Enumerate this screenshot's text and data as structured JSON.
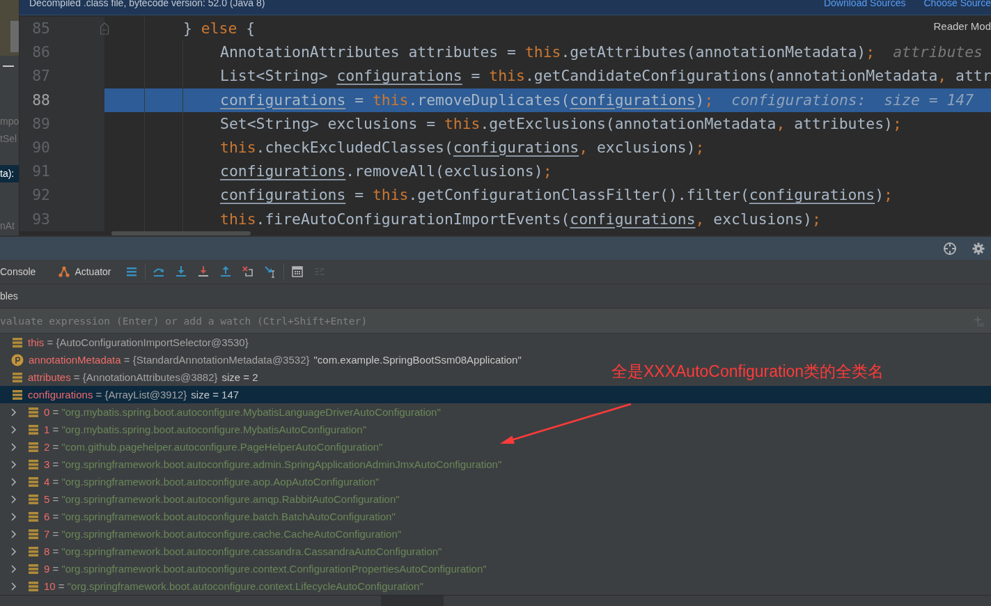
{
  "side_panel": {
    "fragments": [
      {
        "text": "mpo",
        "selected": false
      },
      {
        "text": "tSel",
        "selected": false
      },
      {
        "text": "ta):",
        "selected": true
      },
      {
        "text": "nAt",
        "selected": false
      }
    ]
  },
  "banner": {
    "message": "Decompiled .class file, bytecode version: 52.0 (Java 8)",
    "links": [
      "Download Sources",
      "Choose Source"
    ]
  },
  "editor": {
    "reader_mode": "Reader Mod",
    "lines": [
      {
        "number": "85",
        "current": false,
        "tokens": [
          {
            "kind": "plain",
            "text": "} "
          },
          {
            "kind": "keyword",
            "text": "else"
          },
          {
            "kind": "plain",
            "text": " {"
          }
        ],
        "children": [
          {
            "number": "86",
            "current": false,
            "tokens": [
              {
                "kind": "plain",
                "text": "AnnotationAttributes attributes = "
              },
              {
                "kind": "keyword",
                "text": "this"
              },
              {
                "kind": "plain",
                "text": ".getAttributes(annotationMetadata)"
              },
              {
                "kind": "keyword",
                "text": ";"
              }
            ],
            "hint": "attributes"
          },
          {
            "number": "87",
            "current": false,
            "tokens": [
              {
                "kind": "plain",
                "text": "List<String> "
              },
              {
                "kind": "variable",
                "text": "configurations"
              },
              {
                "kind": "plain",
                "text": " = "
              },
              {
                "kind": "keyword",
                "text": "this"
              },
              {
                "kind": "plain",
                "text": ".getCandidateConfigurations(annotationMetadata"
              },
              {
                "kind": "keyword",
                "text": ","
              },
              {
                "kind": "plain",
                "text": " attr"
              }
            ]
          },
          {
            "number": "88",
            "current": true,
            "tokens": [
              {
                "kind": "variable",
                "text": "configurations"
              },
              {
                "kind": "plain",
                "text": " = "
              },
              {
                "kind": "keyword",
                "text": "this"
              },
              {
                "kind": "plain",
                "text": ".removeDuplicates("
              },
              {
                "kind": "variable",
                "text": "configurations"
              },
              {
                "kind": "plain",
                "text": ")"
              },
              {
                "kind": "keyword",
                "text": ";"
              }
            ],
            "hint": "configurations:  size = 147"
          },
          {
            "number": "89",
            "current": false,
            "tokens": [
              {
                "kind": "plain",
                "text": "Set<String> exclusions = "
              },
              {
                "kind": "keyword",
                "text": "this"
              },
              {
                "kind": "plain",
                "text": ".getExclusions(annotationMetadata"
              },
              {
                "kind": "keyword",
                "text": ","
              },
              {
                "kind": "plain",
                "text": " attributes)"
              },
              {
                "kind": "keyword",
                "text": ";"
              }
            ]
          },
          {
            "number": "90",
            "current": false,
            "tokens": [
              {
                "kind": "keyword",
                "text": "this"
              },
              {
                "kind": "plain",
                "text": ".checkExcludedClasses("
              },
              {
                "kind": "variable",
                "text": "configurations"
              },
              {
                "kind": "keyword",
                "text": ","
              },
              {
                "kind": "plain",
                "text": " exclusions)"
              },
              {
                "kind": "keyword",
                "text": ";"
              }
            ]
          },
          {
            "number": "91",
            "current": false,
            "tokens": [
              {
                "kind": "variable",
                "text": "configurations"
              },
              {
                "kind": "plain",
                "text": ".removeAll(exclusions)"
              },
              {
                "kind": "keyword",
                "text": ";"
              }
            ]
          },
          {
            "number": "92",
            "current": false,
            "tokens": [
              {
                "kind": "variable",
                "text": "configurations"
              },
              {
                "kind": "plain",
                "text": " = "
              },
              {
                "kind": "keyword",
                "text": "this"
              },
              {
                "kind": "plain",
                "text": ".getConfigurationClassFilter().filter("
              },
              {
                "kind": "variable",
                "text": "configurations"
              },
              {
                "kind": "plain",
                "text": ")"
              },
              {
                "kind": "keyword",
                "text": ";"
              }
            ]
          },
          {
            "number": "93",
            "current": false,
            "tokens": [
              {
                "kind": "keyword",
                "text": "this"
              },
              {
                "kind": "plain",
                "text": ".fireAutoConfigurationImportEvents("
              },
              {
                "kind": "variable",
                "text": "configurations"
              },
              {
                "kind": "keyword",
                "text": ","
              },
              {
                "kind": "plain",
                "text": " exclusions)"
              },
              {
                "kind": "keyword",
                "text": ";"
              }
            ]
          }
        ]
      }
    ]
  },
  "debug": {
    "tabs": [
      {
        "label": "Console",
        "kind": "plain"
      },
      {
        "label": "Actuator",
        "kind": "actuator"
      }
    ],
    "toolbar_groups": [
      [
        {
          "kind": "layout",
          "disabled": false
        }
      ],
      [
        {
          "kind": "step-over",
          "disabled": false
        },
        {
          "kind": "step-into",
          "disabled": false
        },
        {
          "kind": "force-step-into",
          "disabled": false
        },
        {
          "kind": "step-out",
          "disabled": false
        },
        {
          "kind": "drop-frame",
          "disabled": false
        },
        {
          "kind": "run-to-cursor",
          "disabled": false
        }
      ],
      [
        {
          "kind": "evaluate",
          "disabled": false
        },
        {
          "kind": "trace",
          "disabled": true
        }
      ]
    ],
    "section_title": "bles",
    "watch_field": {
      "placeholder": "valuate expression (Enter) or add a watch (Ctrl+Shift+Enter)"
    },
    "variables": [
      {
        "kind": "field",
        "name": "this",
        "assign": "=",
        "value": "{AutoConfigurationImportSelector@3530}",
        "selected": false
      },
      {
        "kind": "parameter",
        "name": "annotationMetadata",
        "assign": "=",
        "value": "{StandardAnnotationMetadata@3532}",
        "label": "\"com.example.SpringBootSsm08Application\"",
        "selected": false
      },
      {
        "kind": "field",
        "name": "attributes",
        "assign": "=",
        "value": "{AnnotationAttributes@3882}",
        "label": "size = 2",
        "selected": false
      },
      {
        "kind": "field",
        "name": "configurations",
        "assign": "=",
        "value": "{ArrayList@3912}",
        "label": "size = 147",
        "selected": true,
        "children": [
          {
            "kind": "field",
            "name": "0",
            "assign": "=",
            "value": "\"org.mybatis.spring.boot.autoconfigure.MybatisLanguageDriverAutoConfiguration\"",
            "selected": false,
            "expanded": false
          },
          {
            "kind": "field",
            "name": "1",
            "assign": "=",
            "value": "\"org.mybatis.spring.boot.autoconfigure.MybatisAutoConfiguration\"",
            "selected": false,
            "expanded": false
          },
          {
            "kind": "field",
            "name": "2",
            "assign": "=",
            "value": "\"com.github.pagehelper.autoconfigure.PageHelperAutoConfiguration\"",
            "selected": false,
            "expanded": false
          },
          {
            "kind": "field",
            "name": "3",
            "assign": "=",
            "value": "\"org.springframework.boot.autoconfigure.admin.SpringApplicationAdminJmxAutoConfiguration\"",
            "selected": false,
            "expanded": false
          },
          {
            "kind": "field",
            "name": "4",
            "assign": "=",
            "value": "\"org.springframework.boot.autoconfigure.aop.AopAutoConfiguration\"",
            "selected": false,
            "expanded": false
          },
          {
            "kind": "field",
            "name": "5",
            "assign": "=",
            "value": "\"org.springframework.boot.autoconfigure.amqp.RabbitAutoConfiguration\"",
            "selected": false,
            "expanded": false
          },
          {
            "kind": "field",
            "name": "6",
            "assign": "=",
            "value": "\"org.springframework.boot.autoconfigure.batch.BatchAutoConfiguration\"",
            "selected": false,
            "expanded": false
          },
          {
            "kind": "field",
            "name": "7",
            "assign": "=",
            "value": "\"org.springframework.boot.autoconfigure.cache.CacheAutoConfiguration\"",
            "selected": false,
            "expanded": false
          },
          {
            "kind": "field",
            "name": "8",
            "assign": "=",
            "value": "\"org.springframework.boot.autoconfigure.cassandra.CassandraAutoConfiguration\"",
            "selected": false,
            "expanded": false
          },
          {
            "kind": "field",
            "name": "9",
            "assign": "=",
            "value": "\"org.springframework.boot.autoconfigure.context.ConfigurationPropertiesAutoConfiguration\"",
            "selected": false,
            "expanded": false
          },
          {
            "kind": "field",
            "name": "10",
            "assign": "=",
            "value": "\"org.springframework.boot.autoconfigure.context.LifecycleAutoConfiguration\"",
            "selected": false,
            "expanded": false
          }
        ]
      }
    ]
  },
  "annotation": {
    "text": "全是XXXAutoConfiguration类的全类名"
  }
}
